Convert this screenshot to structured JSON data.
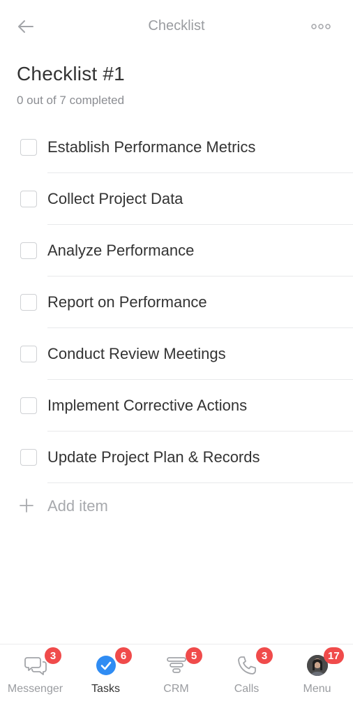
{
  "header": {
    "title": "Checklist",
    "back_icon": "arrow-left-icon",
    "more_icon": "more-dots-icon"
  },
  "checklist": {
    "title": "Checklist #1",
    "progress_text": "0 out of 7 completed",
    "items": [
      {
        "label": "Establish Performance Metrics",
        "checked": false
      },
      {
        "label": "Collect Project Data",
        "checked": false
      },
      {
        "label": "Analyze Performance",
        "checked": false
      },
      {
        "label": "Report on Performance",
        "checked": false
      },
      {
        "label": "Conduct Review Meetings",
        "checked": false
      },
      {
        "label": "Implement Corrective Actions",
        "checked": false
      },
      {
        "label": "Update Project Plan & Records",
        "checked": false
      }
    ],
    "add_item_label": "Add item"
  },
  "tabbar": {
    "tabs": [
      {
        "label": "Messenger",
        "badge": "3",
        "icon": "chat-bubbles-icon",
        "active": false
      },
      {
        "label": "Tasks",
        "badge": "6",
        "icon": "check-circle-icon",
        "active": true
      },
      {
        "label": "CRM",
        "badge": "5",
        "icon": "funnel-icon",
        "active": false
      },
      {
        "label": "Calls",
        "badge": "3",
        "icon": "phone-icon",
        "active": false
      },
      {
        "label": "Menu",
        "badge": "17",
        "icon": "avatar",
        "active": false
      }
    ]
  },
  "colors": {
    "accent": "#2f8cf3",
    "badge": "#f04b4b",
    "text": "#333333",
    "muted": "#9a9ca0"
  }
}
